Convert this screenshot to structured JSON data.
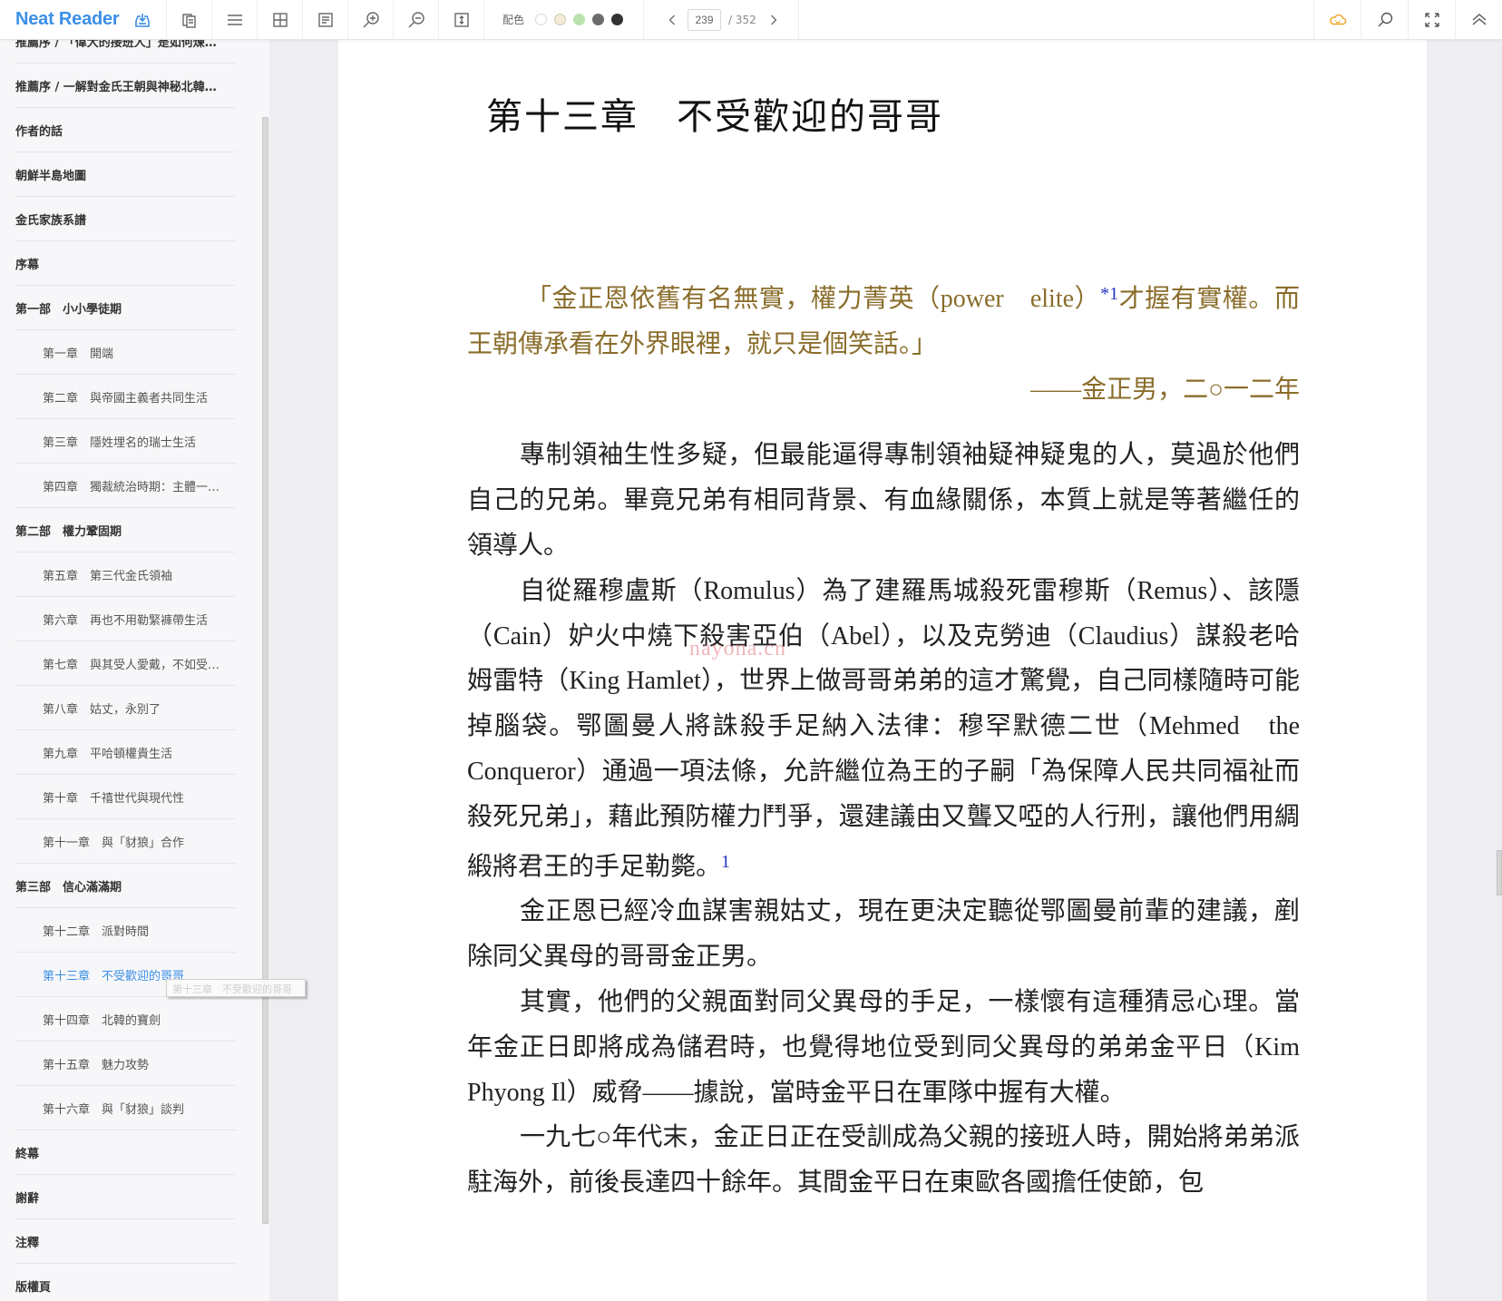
{
  "app": {
    "name": "Neat Reader",
    "brand_color": "#3b8fe6"
  },
  "toolbar": {
    "icons": [
      "import-icon",
      "copy-pages-icon",
      "toc-list-icon",
      "grid-view-icon",
      "notes-icon",
      "zoom-in-icon",
      "zoom-out-icon",
      "fit-page-icon"
    ],
    "theme_label": "配色",
    "theme_swatches": [
      "#ffffff",
      "#f3ecd9",
      "#b9e3ad",
      "#6b6b6b",
      "#333333"
    ],
    "current_page": "239",
    "total_pages": "/ 352",
    "right_icons": [
      "cloud-sync-icon",
      "search-icon",
      "fullscreen-icon",
      "collapse-up-icon"
    ],
    "cloud_color": "#f0a020"
  },
  "toc": {
    "items": [
      {
        "label": "推薦序 / 「偉大的接班人」是如何煉…",
        "level": 1
      },
      {
        "label": "推薦序 / 一解對金氏王朝與神秘北韓…",
        "level": 1
      },
      {
        "label": "作者的話",
        "level": 1
      },
      {
        "label": "朝鮮半島地圖",
        "level": 1
      },
      {
        "label": "金氏家族系譜",
        "level": 1
      },
      {
        "label": "序幕",
        "level": 1
      },
      {
        "label": "第一部　小小學徒期",
        "level": 1
      },
      {
        "label": "第一章　開端",
        "level": 2
      },
      {
        "label": "第二章　與帝國主義者共同生活",
        "level": 2
      },
      {
        "label": "第三章　隱姓埋名的瑞士生活",
        "level": 2
      },
      {
        "label": "第四章　獨裁統治時期：主體一…",
        "level": 2
      },
      {
        "label": "第二部　權力鞏固期",
        "level": 1
      },
      {
        "label": "第五章　第三代金氏領袖",
        "level": 2
      },
      {
        "label": "第六章　再也不用勒緊褲帶生活",
        "level": 2
      },
      {
        "label": "第七章　與其受人愛戴，不如受…",
        "level": 2
      },
      {
        "label": "第八章　姑丈，永別了",
        "level": 2
      },
      {
        "label": "第九章　平哈頓權貴生活",
        "level": 2
      },
      {
        "label": "第十章　千禧世代與現代性",
        "level": 2
      },
      {
        "label": "第十一章　與「豺狼」合作",
        "level": 2
      },
      {
        "label": "第三部　信心滿滿期",
        "level": 1
      },
      {
        "label": "第十二章　派對時間",
        "level": 2
      },
      {
        "label": "第十三章　不受歡迎的哥哥",
        "level": 2,
        "active": true
      },
      {
        "label": "第十四章　北韓的寶劍",
        "level": 2
      },
      {
        "label": "第十五章　魅力攻勢",
        "level": 2
      },
      {
        "label": "第十六章　與「豺狼」談判",
        "level": 2
      },
      {
        "label": "終幕",
        "level": 1
      },
      {
        "label": "謝辭",
        "level": 1
      },
      {
        "label": "注釋",
        "level": 1
      },
      {
        "label": "版權頁",
        "level": 1
      }
    ],
    "drag_ghost_label": "第十三章　不受歡迎的哥哥",
    "active_color": "#3b8fe6"
  },
  "book": {
    "chapter_title": "第十三章　不受歡迎的哥哥",
    "epigraph": {
      "text_before_note": "「金正恩依舊有名無實，權力菁英（power　elite）",
      "note_marker": "*1",
      "text_after_note": "才握有實權。而王朝傳承看在外界眼裡，就只是個笑話。」",
      "source": "——金正男，二○一二年",
      "color": "#8a6d2b"
    },
    "paragraphs": [
      {
        "text": "專制領袖生性多疑，但最能逼得專制領袖疑神疑鬼的人，莫過於他們自己的兄弟。畢竟兄弟有相同背景、有血緣關係，本質上就是等著繼任的領導人。"
      },
      {
        "text": "自從羅穆盧斯（Romulus）為了建羅馬城殺死雷穆斯（Remus）、該隱（Cain）妒火中燒下殺害亞伯（Abel），以及克勞迪（Claudius）謀殺老哈姆雷特（King Hamlet），世界上做哥哥弟弟的這才驚覺，自己同樣隨時可能掉腦袋。鄂圖曼人將誅殺手足納入法律：穆罕默德二世（Mehmed　the　Conqueror）通過一項法條，允許繼位為王的子嗣「為保障人民共同福祉而殺死兄弟」，藉此預防權力鬥爭，還建議由又聾又啞的人行刑，讓他們用綢緞將君王的手足勒斃。",
        "note": "1"
      },
      {
        "text": "金正恩已經冷血謀害親姑丈，現在更決定聽從鄂圖曼前輩的建議，剷除同父異母的哥哥金正男。"
      },
      {
        "text": "其實，他們的父親面對同父異母的手足，一樣懷有這種猜忌心理。當年金正日即將成為儲君時，也覺得地位受到同父異母的弟弟金平日（Kim Phyong Il）威脅——據說，當時金平日在軍隊中握有大權。"
      },
      {
        "text": "一九七○年代末，金正日正在受訓成為父親的接班人時，開始將弟弟派駐海外，前後長達四十餘年。其間金平日在東歐各國擔任使節，包"
      }
    ],
    "note_color": "#2233bb",
    "watermark": "nayona.cn"
  }
}
